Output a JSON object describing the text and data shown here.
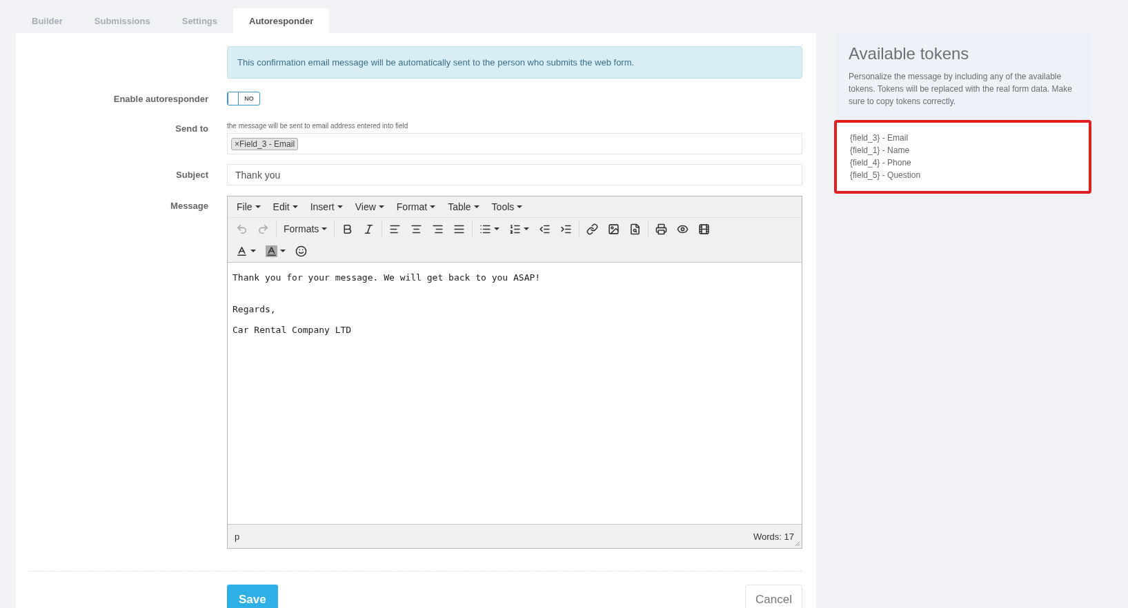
{
  "tabs": [
    {
      "label": "Builder",
      "selected": false
    },
    {
      "label": "Submissions",
      "selected": false
    },
    {
      "label": "Settings",
      "selected": false
    },
    {
      "label": "Autoresponder",
      "selected": true
    }
  ],
  "notice": "This confirmation email message will be automatically sent to the person who submits the web form.",
  "enable_autoresponder": {
    "label": "Enable autoresponder",
    "on": false,
    "state_text": "NO"
  },
  "send_to": {
    "label": "Send to",
    "hint": "the message will be sent to email address entered into field",
    "tags": [
      {
        "remove": "×",
        "text": "Field_3 - Email"
      }
    ]
  },
  "subject": {
    "label": "Subject",
    "value": "Thank you"
  },
  "message": {
    "label": "Message",
    "menu": [
      "File",
      "Edit",
      "Insert",
      "View",
      "Format",
      "Table",
      "Tools"
    ],
    "toolbar_rows": [
      [
        {
          "kind": "undo",
          "disabled": true
        },
        {
          "kind": "redo",
          "disabled": true
        },
        {
          "kind": "separator"
        },
        {
          "kind": "dropdown",
          "label": "Formats"
        },
        {
          "kind": "separator"
        },
        {
          "kind": "bold",
          "disabled": false
        },
        {
          "kind": "italic",
          "disabled": false
        },
        {
          "kind": "separator"
        },
        {
          "kind": "align-left",
          "disabled": false
        },
        {
          "kind": "align-center",
          "disabled": false
        },
        {
          "kind": "align-right",
          "disabled": false
        },
        {
          "kind": "align-justify",
          "disabled": false
        },
        {
          "kind": "separator"
        },
        {
          "kind": "bullet-list",
          "disabled": false,
          "split": true
        },
        {
          "kind": "numbered-list",
          "disabled": false,
          "split": true
        },
        {
          "kind": "outdent",
          "disabled": false
        },
        {
          "kind": "indent",
          "disabled": false
        },
        {
          "kind": "separator"
        },
        {
          "kind": "link",
          "disabled": false
        },
        {
          "kind": "image",
          "disabled": false
        },
        {
          "kind": "search",
          "disabled": false
        },
        {
          "kind": "separator"
        },
        {
          "kind": "print",
          "disabled": false
        },
        {
          "kind": "preview",
          "disabled": false
        },
        {
          "kind": "media",
          "disabled": false
        }
      ],
      [
        {
          "kind": "text-color",
          "disabled": false,
          "split": true
        },
        {
          "kind": "highlight-color",
          "disabled": false,
          "split": true
        },
        {
          "kind": "emoji",
          "disabled": false
        }
      ]
    ],
    "paragraphs": [
      {
        "kind": "text",
        "text": "Thank you for your message. We will get back to you ASAP!"
      },
      {
        "kind": "blank"
      },
      {
        "kind": "text",
        "text": "Regards,"
      },
      {
        "kind": "text",
        "text": "Car Rental Company LTD"
      }
    ],
    "path": "p",
    "word_count": "Words: 17"
  },
  "buttons": {
    "save": "Save",
    "cancel": "Cancel"
  },
  "tokens_panel": {
    "title": "Available tokens",
    "description": "Personalize the message by including any of the available tokens. Tokens will be replaced with the real form data. Make sure to copy tokens correctly.",
    "highlighted": true,
    "tokens": [
      "{field_3} - Email",
      "{field_1} - Name",
      "{field_4} - Phone",
      "{field_5} - Question"
    ]
  }
}
